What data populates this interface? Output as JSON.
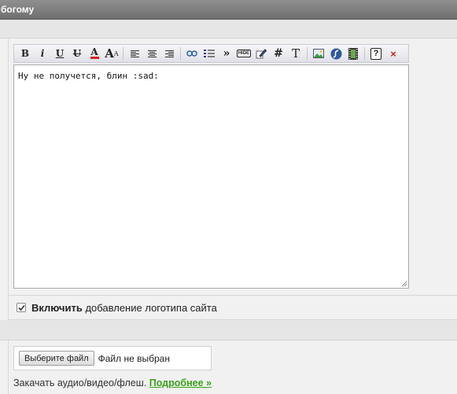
{
  "header": {
    "title": "богому"
  },
  "toolbar": {
    "buttons": [
      {
        "name": "bold-button",
        "glyph": "B"
      },
      {
        "name": "italic-button",
        "glyph": "i"
      },
      {
        "name": "underline-button",
        "glyph": "U"
      },
      {
        "name": "strikethrough-button",
        "glyph": "U"
      },
      {
        "name": "font-color-button",
        "glyph": "A"
      },
      {
        "name": "font-size-button",
        "glyph": "A"
      },
      {
        "name": "align-left-button",
        "glyph": ""
      },
      {
        "name": "align-center-button",
        "glyph": ""
      },
      {
        "name": "align-right-button",
        "glyph": ""
      },
      {
        "name": "link-button",
        "glyph": ""
      },
      {
        "name": "list-button",
        "glyph": ""
      },
      {
        "name": "quote-button",
        "glyph": "»"
      },
      {
        "name": "hide-button",
        "glyph": "HIDE"
      },
      {
        "name": "edit-button",
        "glyph": ""
      },
      {
        "name": "code-button",
        "glyph": "#"
      },
      {
        "name": "text-button",
        "glyph": "T"
      },
      {
        "name": "image-button",
        "glyph": ""
      },
      {
        "name": "flash-button",
        "glyph": ""
      },
      {
        "name": "video-button",
        "glyph": ""
      },
      {
        "name": "help-button",
        "glyph": "?"
      },
      {
        "name": "clear-button",
        "glyph": "×"
      }
    ]
  },
  "editor": {
    "text": "Ну не получется, блин :sad:"
  },
  "logo_option": {
    "bold": "Включить",
    "rest": " добавление логотипа сайта",
    "checked": true
  },
  "file_upload": {
    "button_label": "Выберите файл",
    "status": "Файл не выбран"
  },
  "media": {
    "text": "Закачать аудио/видео/флеш. ",
    "link": "Подробнее »"
  },
  "colors": {
    "link": "#3aa21a",
    "header_bg": "#7f7f7f"
  }
}
